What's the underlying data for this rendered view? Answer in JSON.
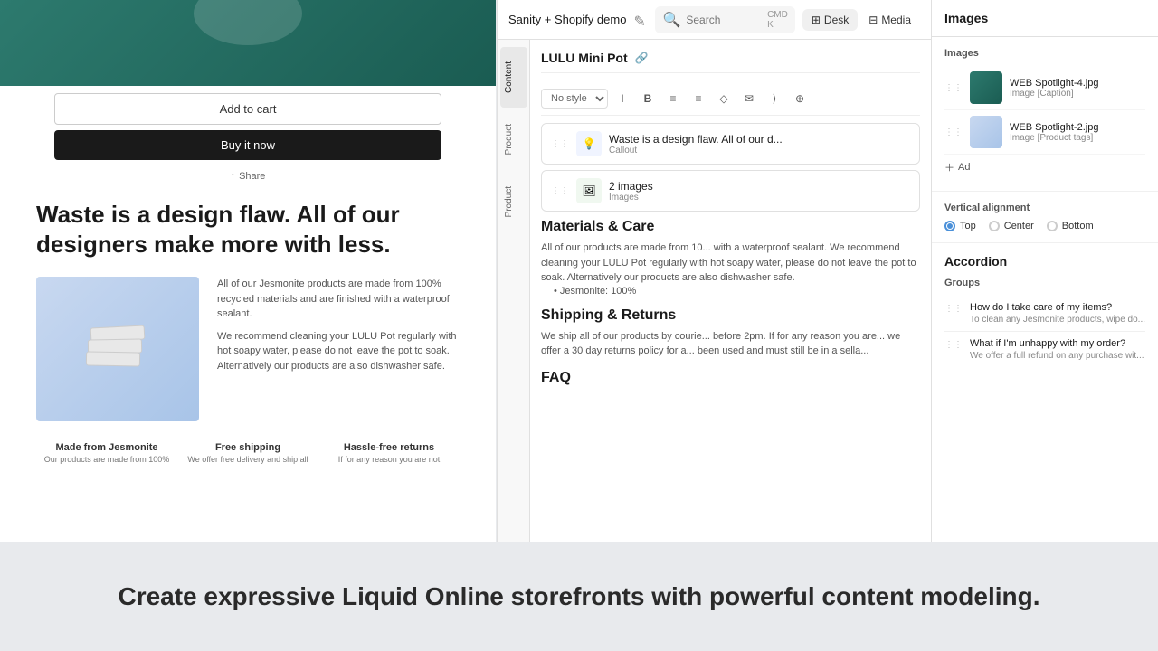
{
  "app": {
    "title": "Sanity + Shopify demo",
    "search_placeholder": "Search",
    "search_shortcut": "CMD K"
  },
  "tabs": {
    "desk_label": "Desk",
    "media_label": "Media"
  },
  "vertical_tabs": [
    {
      "id": "content",
      "label": "Content"
    },
    {
      "id": "product1",
      "label": "Product"
    },
    {
      "id": "product2",
      "label": "Product"
    }
  ],
  "document": {
    "title": "LULU Mini Pot"
  },
  "toolbar": {
    "style_placeholder": "No style",
    "buttons": [
      "I",
      "B",
      "≡",
      "≡",
      "◇",
      "✉",
      "⟩",
      "⊕"
    ]
  },
  "preview": {
    "add_to_cart": "Add to cart",
    "buy_now": "Buy it now",
    "share": "Share",
    "tagline": "Waste is a design flaw. All of our designers make more with less.",
    "feature_text_1": "All of our Jesmonite products are made from 100% recycled materials and are finished with a waterproof sealant.",
    "feature_text_2": "We recommend cleaning your LULU Pot regularly with hot soapy water, please do not leave the pot to soak. Alternatively our products are also dishwasher safe.",
    "features": [
      {
        "title": "Made from Jesmonite",
        "desc": "Our products are made from 100%"
      },
      {
        "title": "Free shipping",
        "desc": "We offer free delivery and ship all"
      },
      {
        "title": "Hassle-free returns",
        "desc": "If for any reason you are not"
      }
    ]
  },
  "content_blocks": {
    "callout": {
      "title": "Callout",
      "text": "Waste is a design flaw. All of our d..."
    },
    "images": {
      "title": "Images",
      "subtitle": "Images",
      "count": "2 images"
    }
  },
  "materials_section": {
    "heading": "Materials & Care",
    "body": "All of our products are made from 10... with a waterproof sealant. We recommend cleaning your LULU Pot regularly with hot soapy water, please do not leave the pot to soak. Alternatively our products are also dishwasher safe.",
    "bullet": "Jesmonite: 100%"
  },
  "shipping_section": {
    "heading": "Shipping & Returns",
    "body": "We ship all of our products by courie... before 2pm. If for any reason you are... we offer a 30 day returns policy for a... been used and must still be in a sella..."
  },
  "faq_section": {
    "heading": "FAQ"
  },
  "right_panel": {
    "images_section": {
      "title": "Images",
      "label": "Images",
      "items": [
        {
          "name": "WEB Spotlight-4.jpg",
          "tag": "Image [Caption]"
        },
        {
          "name": "WEB Spotlight-2.jpg",
          "tag": "Image [Product tags]"
        }
      ],
      "add_label": "Ad"
    },
    "vertical_alignment": {
      "label": "Vertical alignment",
      "options": [
        "Top",
        "Center",
        "Bottom"
      ],
      "selected": "Top"
    },
    "accordion": {
      "title": "Accordion",
      "label": "Groups",
      "groups": [
        {
          "title": "How do I take care of my items?",
          "subtitle": "To clean any Jesmonite products, wipe do..."
        },
        {
          "title": "What if I'm unhappy with my order?",
          "subtitle": "We offer a full refund on any purchase wit..."
        }
      ]
    }
  },
  "bottom": {
    "tagline": "Create expressive Liquid Online storefronts with powerful content modeling."
  }
}
